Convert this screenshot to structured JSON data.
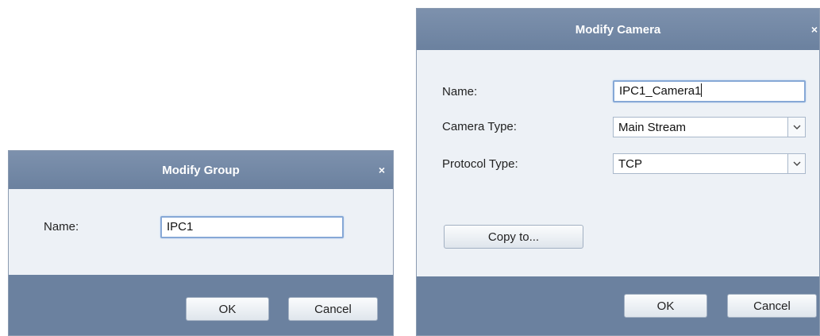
{
  "group_dialog": {
    "title": "Modify Group",
    "close_glyph": "×",
    "name_label": "Name:",
    "name_value": "IPC1",
    "ok_label": "OK",
    "cancel_label": "Cancel"
  },
  "camera_dialog": {
    "title": "Modify Camera",
    "close_glyph": "×",
    "name_label": "Name:",
    "name_value": "IPC1_Camera1",
    "camera_type_label": "Camera Type:",
    "camera_type_value": "Main Stream",
    "protocol_type_label": "Protocol Type:",
    "protocol_type_value": "TCP",
    "copy_to_label": "Copy to...",
    "ok_label": "OK",
    "cancel_label": "Cancel"
  },
  "icons": {
    "close": "close-icon",
    "dropdown": "chevron-down-icon"
  },
  "colors": {
    "titlebar": "#7588a6",
    "dialog_body": "#edf1f6",
    "footer": "#6b819f"
  }
}
